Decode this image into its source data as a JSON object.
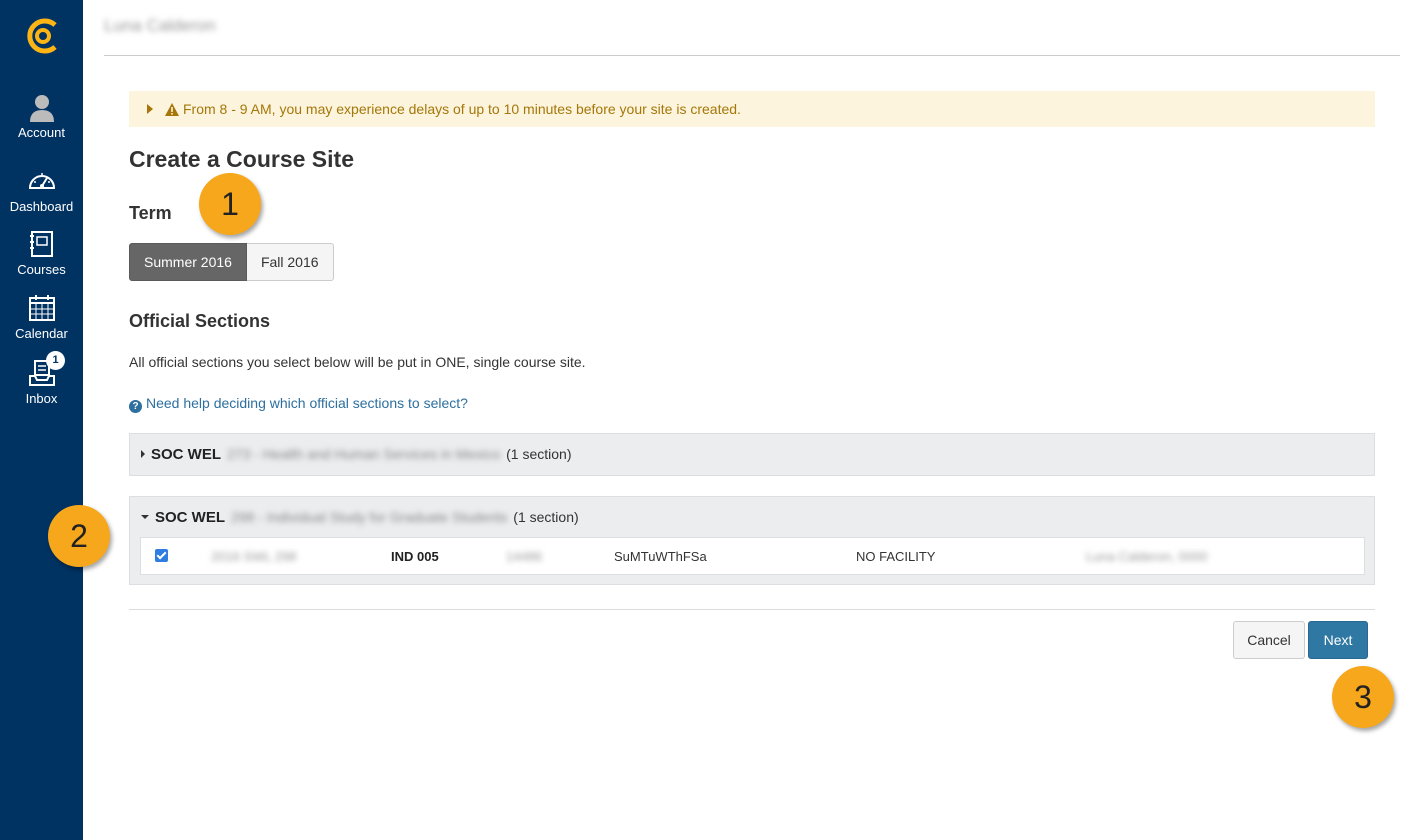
{
  "sidebar": {
    "items": [
      {
        "label": "Account",
        "icon": "account-icon"
      },
      {
        "label": "Dashboard",
        "icon": "dashboard-icon"
      },
      {
        "label": "Courses",
        "icon": "courses-icon"
      },
      {
        "label": "Calendar",
        "icon": "calendar-icon"
      },
      {
        "label": "Inbox",
        "icon": "inbox-icon",
        "badge": "1"
      }
    ]
  },
  "header": {
    "user_name": "Luna Calderon"
  },
  "alert": {
    "text": "From 8 - 9 AM, you may experience delays of up to 10 minutes before your site is created."
  },
  "page": {
    "title": "Create a Course Site",
    "term_heading": "Term",
    "terms": [
      "Summer 2016",
      "Fall 2016"
    ],
    "sections_heading": "Official Sections",
    "sections_desc": "All official sections you select below will be put in ONE, single course site.",
    "help_link": "Need help deciding which official sections to select?"
  },
  "courses": [
    {
      "code": "SOC WEL",
      "blurred_title": "273 - Health and Human Services in Mexico",
      "count": "(1 section)",
      "expanded": false
    },
    {
      "code": "SOC WEL",
      "blurred_title": "298 - Individual Study for Graduate Students",
      "count": "(1 section)",
      "expanded": true,
      "section": {
        "blur1": "2016 SWL 298",
        "label": "IND 005",
        "blur2": "14486",
        "days": "SuMTuWThFSa",
        "location": "NO FACILITY",
        "blur3": "Luna Calderon, 0000",
        "checked": true
      }
    }
  ],
  "buttons": {
    "cancel": "Cancel",
    "next": "Next"
  },
  "callouts": [
    "1",
    "2",
    "3"
  ],
  "colors": {
    "sidebar": "#003262",
    "accent": "#f7a71b",
    "primary": "#2f78a3"
  }
}
